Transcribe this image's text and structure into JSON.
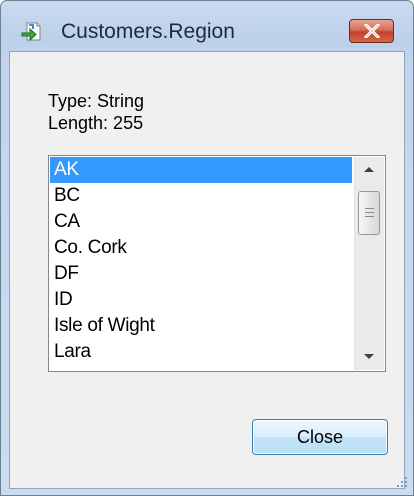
{
  "window": {
    "title": "Customers.Region",
    "title_icon": "arrow-form-icon",
    "close_icon": "close-x-icon"
  },
  "info": {
    "type_label": "Type: String",
    "length_label": "Length: 255"
  },
  "list": {
    "items": [
      "AK",
      "BC",
      "CA",
      "Co. Cork",
      "DF",
      "ID",
      "Isle of Wight",
      "Lara"
    ],
    "selected": "AK"
  },
  "buttons": {
    "close_label": "Close"
  },
  "colors": {
    "selection": "#3399ff",
    "window_frame": "#bcd0ea",
    "close_caption": "#c4412a"
  }
}
